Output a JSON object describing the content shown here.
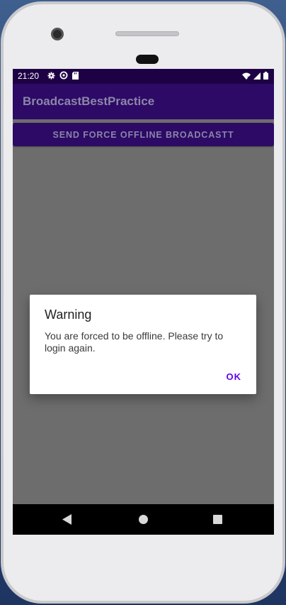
{
  "status_bar": {
    "time": "21:20",
    "left_icons": [
      "gear-icon",
      "sync-icon",
      "sd-card-icon"
    ],
    "right_icons": [
      "wifi-icon",
      "signal-icon",
      "battery-icon"
    ]
  },
  "app_bar": {
    "title": "BroadcastBestPractice"
  },
  "main": {
    "send_button_label": "SEND FORCE OFFLINE BROADCASTT"
  },
  "dialog": {
    "title": "Warning",
    "message": "You are forced to be offline. Please try to login again.",
    "ok_label": "OK"
  },
  "nav_bar": {
    "icons": [
      "back-icon",
      "home-icon",
      "recents-icon"
    ]
  },
  "colors": {
    "status_bar": "#1d0144",
    "app_bar": "#2c0a66",
    "scrim": "#6d6d6d",
    "accent": "#6200ee"
  }
}
